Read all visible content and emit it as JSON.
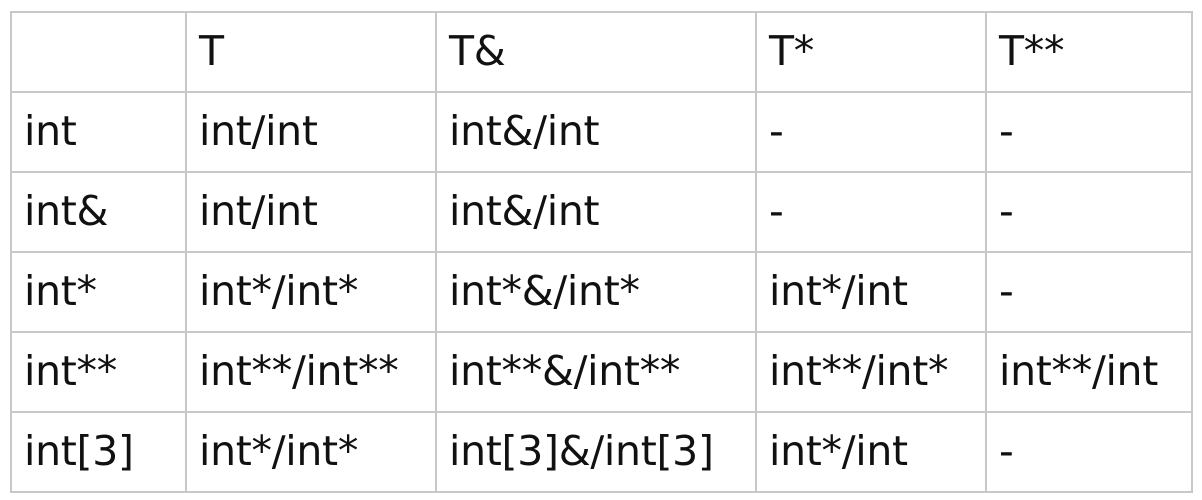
{
  "table": {
    "name": "type-deduction-table",
    "corner_label": "",
    "column_headers": [
      "",
      "T",
      "T&",
      "T*",
      "T**"
    ],
    "rows": [
      {
        "label": "int",
        "cells": [
          "int/int",
          "int&/int",
          "-",
          "-"
        ]
      },
      {
        "label": "int&",
        "cells": [
          "int/int",
          "int&/int",
          "-",
          "-"
        ]
      },
      {
        "label": "int*",
        "cells": [
          "int*/int*",
          "int*&/int*",
          "int*/int",
          "-"
        ]
      },
      {
        "label": "int**",
        "cells": [
          "int**/int**",
          "int**&/int**",
          "int**/int*",
          "int**/int"
        ]
      },
      {
        "label": "int[3]",
        "cells": [
          "int*/int*",
          "int[3]&/int[3]",
          "int*/int",
          "-"
        ]
      }
    ]
  },
  "style": {
    "border_color": "#c8c8c8",
    "text_color": "#111111",
    "background": "#ffffff"
  }
}
